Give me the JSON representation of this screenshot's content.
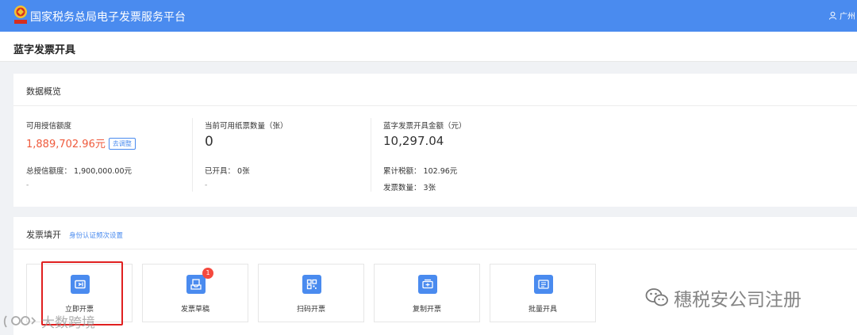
{
  "header": {
    "app_title": "国家税务总局电子发票服务平台",
    "user_label": "广州",
    "logo_icon": "tax-emblem-icon",
    "user_icon": "user-icon"
  },
  "page": {
    "title": "蓝字发票开具"
  },
  "overview": {
    "heading": "数据概览",
    "credit": {
      "label": "可用授信额度",
      "value": "1,889,702.96元",
      "adjust_button": "去调整",
      "total_label": "总授信额度：",
      "total_value": "1,900,000.00元",
      "extra": "-"
    },
    "paper": {
      "label": "当前可用纸票数量（张）",
      "value": "0",
      "issued_label": "已开具：",
      "issued_value": "0张",
      "extra": "-"
    },
    "amount": {
      "label": "蓝字发票开具金额（元）",
      "value": "10,297.04",
      "tax_label": "累计税额：",
      "tax_value": "102.96元",
      "count_label": "发票数量：",
      "count_value": "3张"
    }
  },
  "fill": {
    "heading": "发票填开",
    "auth_link": "身份认证频次设置",
    "tiles": [
      {
        "label": "立即开票",
        "icon": "invoice-ticket-icon"
      },
      {
        "label": "发票草稿",
        "icon": "draft-inbox-icon",
        "badge": "1"
      },
      {
        "label": "扫码开票",
        "icon": "qr-scan-icon"
      },
      {
        "label": "复制开票",
        "icon": "copy-ticket-icon"
      },
      {
        "label": "批量开具",
        "icon": "batch-ticket-icon"
      }
    ]
  },
  "watermarks": {
    "right_text": "穗税安公司注册",
    "left_text": "大数跨境"
  },
  "colors": {
    "header_bg": "#4a8bef",
    "accent": "#4a8bef",
    "amount_red": "#ef5a3c",
    "highlight_red": "#e02020",
    "badge_red": "#f5493e"
  }
}
